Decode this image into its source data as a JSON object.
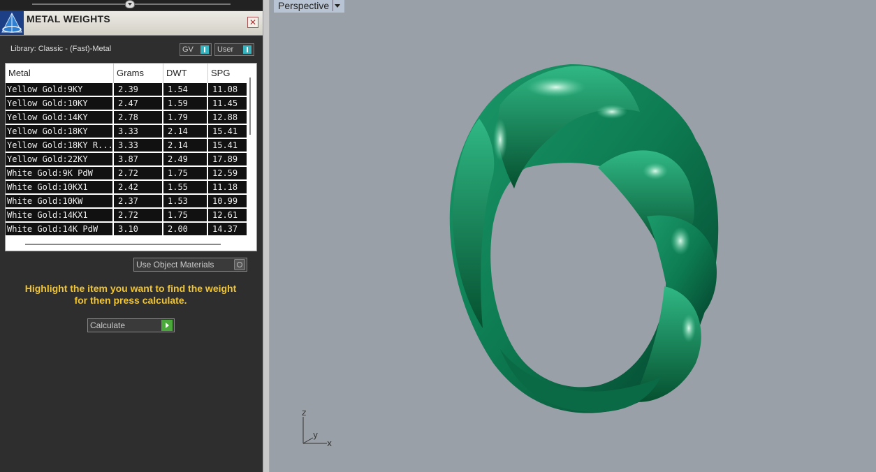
{
  "panel": {
    "title": "METAL WEIGHTS",
    "close": "✕",
    "library_label": "Library: Classic - (Fast)-Metal",
    "toggles": {
      "gv": "GV",
      "user": "User"
    },
    "columns": [
      "Metal",
      "Grams",
      "DWT",
      "SPG"
    ],
    "rows": [
      [
        "Yellow Gold:9KY",
        "2.39",
        "1.54",
        "11.08"
      ],
      [
        "Yellow Gold:10KY",
        "2.47",
        "1.59",
        "11.45"
      ],
      [
        "Yellow Gold:14KY",
        "2.78",
        "1.79",
        "12.88"
      ],
      [
        "Yellow Gold:18KY",
        "3.33",
        "2.14",
        "15.41"
      ],
      [
        "Yellow Gold:18KY R...",
        "3.33",
        "2.14",
        "15.41"
      ],
      [
        "Yellow Gold:22KY",
        "3.87",
        "2.49",
        "17.89"
      ],
      [
        "White Gold:9K PdW",
        "2.72",
        "1.75",
        "12.59"
      ],
      [
        "White Gold:10KX1",
        "2.42",
        "1.55",
        "11.18"
      ],
      [
        "White Gold:10KW",
        "2.37",
        "1.53",
        "10.99"
      ],
      [
        "White Gold:14KX1",
        "2.72",
        "1.75",
        "12.61"
      ],
      [
        "White Gold:14K PdW",
        "3.10",
        "2.00",
        "14.37"
      ]
    ],
    "use_object_materials": "Use Object Materials",
    "instruction_line1": "Highlight the item you want to find the weight",
    "instruction_line2": "for then press calculate.",
    "calculate": "Calculate"
  },
  "viewport": {
    "label": "Perspective",
    "axis_z": "z",
    "axis_y": "y",
    "axis_x": "x"
  },
  "colors": {
    "ring": "#0e7a52",
    "viewport_bg": "#9aa0a7",
    "instruction": "#f2c530"
  }
}
